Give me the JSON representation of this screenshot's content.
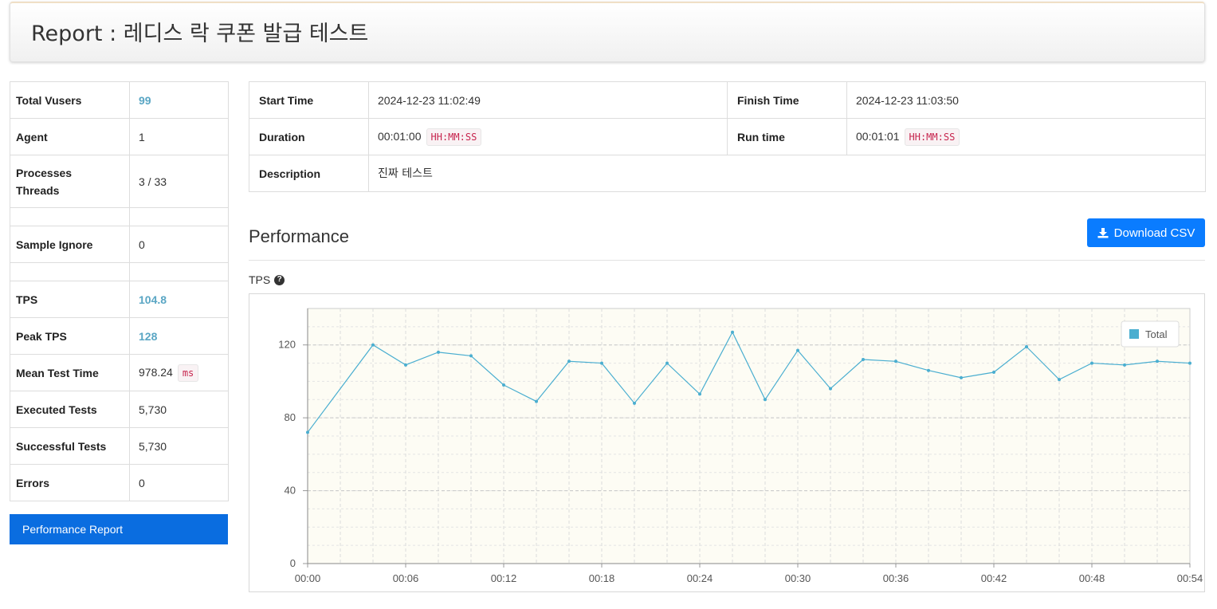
{
  "header": {
    "title": "Report : 레디스 락 쿠폰 발급 테스트"
  },
  "stats": {
    "total_vusers": {
      "label": "Total Vusers",
      "value": "99"
    },
    "agent": {
      "label": "Agent",
      "value": "1"
    },
    "processes_threads": {
      "label_1": "Processes",
      "label_2": "Threads",
      "value": "3 / 33"
    },
    "sample_ignore": {
      "label": "Sample Ignore",
      "value": "0"
    },
    "tps": {
      "label": "TPS",
      "value": "104.8"
    },
    "peak_tps": {
      "label": "Peak TPS",
      "value": "128"
    },
    "mean_test_time": {
      "label": "Mean Test Time",
      "value": "978.24",
      "unit": "ms"
    },
    "executed_tests": {
      "label": "Executed Tests",
      "value": "5,730"
    },
    "successful_tests": {
      "label": "Successful Tests",
      "value": "5,730"
    },
    "errors": {
      "label": "Errors",
      "value": "0"
    }
  },
  "sidebar": {
    "performance_report_label": "Performance Report"
  },
  "info": {
    "start_time": {
      "label": "Start Time",
      "value": "2024-12-23 11:02:49"
    },
    "finish_time": {
      "label": "Finish Time",
      "value": "2024-12-23 11:03:50"
    },
    "duration": {
      "label": "Duration",
      "value": "00:01:00",
      "unit": "HH:MM:SS"
    },
    "run_time": {
      "label": "Run time",
      "value": "00:01:01",
      "unit": "HH:MM:SS"
    },
    "description": {
      "label": "Description",
      "value": "진짜 테스트"
    }
  },
  "performance": {
    "title": "Performance",
    "download_label": "Download CSV",
    "tps_label": "TPS"
  },
  "colors": {
    "line": "#4aaed0",
    "button_primary": "#0a7cff",
    "report_button": "#0a6de0",
    "plot_bg": "#fdfcf4"
  },
  "chart_data": {
    "type": "line",
    "title": "",
    "xlabel": "",
    "ylabel": "",
    "x_tick_labels": [
      "00:00",
      "00:06",
      "00:12",
      "00:18",
      "00:24",
      "00:30",
      "00:36",
      "00:42",
      "00:48",
      "00:54"
    ],
    "y_tick_labels": [
      "0",
      "40",
      "80",
      "120"
    ],
    "xlim": [
      0,
      54
    ],
    "ylim": [
      0,
      140
    ],
    "grid": true,
    "legend_position": "top-right",
    "series": [
      {
        "name": "Total",
        "x": [
          0,
          4,
          6,
          8,
          10,
          12,
          14,
          16,
          18,
          20,
          22,
          24,
          26,
          28,
          30,
          32,
          34,
          36,
          38,
          40,
          42,
          44,
          46,
          48,
          50,
          52,
          54
        ],
        "y": [
          72,
          120,
          109,
          116,
          114,
          98,
          89,
          111,
          110,
          88,
          110,
          93,
          127,
          90,
          117,
          96,
          112,
          111,
          106,
          102,
          105,
          119,
          101,
          110,
          109,
          111,
          110
        ]
      }
    ]
  }
}
